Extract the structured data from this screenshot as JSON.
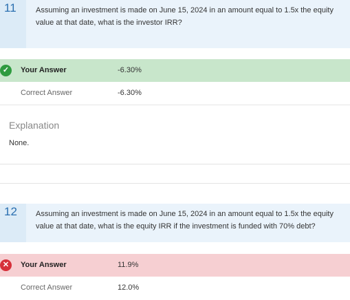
{
  "questions": [
    {
      "number": "11",
      "text": "Assuming an investment is made on June 15, 2024 in an amount equal to 1.5x the equity value at that date, what is the investor IRR?",
      "your_answer_label": "Your Answer",
      "your_answer_value": "-6.30%",
      "correct_answer_label": "Correct Answer",
      "correct_answer_value": "-6.30%",
      "status": "correct",
      "explanation_title": "Explanation",
      "explanation_body": "None."
    },
    {
      "number": "12",
      "text": "Assuming an investment is made on June 15, 2024 in an amount equal to 1.5x the equity value at that date, what is the equity IRR if the investment is funded with 70% debt?",
      "your_answer_label": "Your Answer",
      "your_answer_value": "11.9%",
      "correct_answer_label": "Correct Answer",
      "correct_answer_value": "12.0%",
      "status": "incorrect"
    }
  ],
  "icons": {
    "correct": "check-circle-icon",
    "incorrect": "x-circle-icon"
  },
  "colors": {
    "correct_bg": "#c8e6cb",
    "incorrect_bg": "#f6cfd2",
    "question_bg": "#eaf3fb",
    "accent": "#2a6fb0"
  }
}
